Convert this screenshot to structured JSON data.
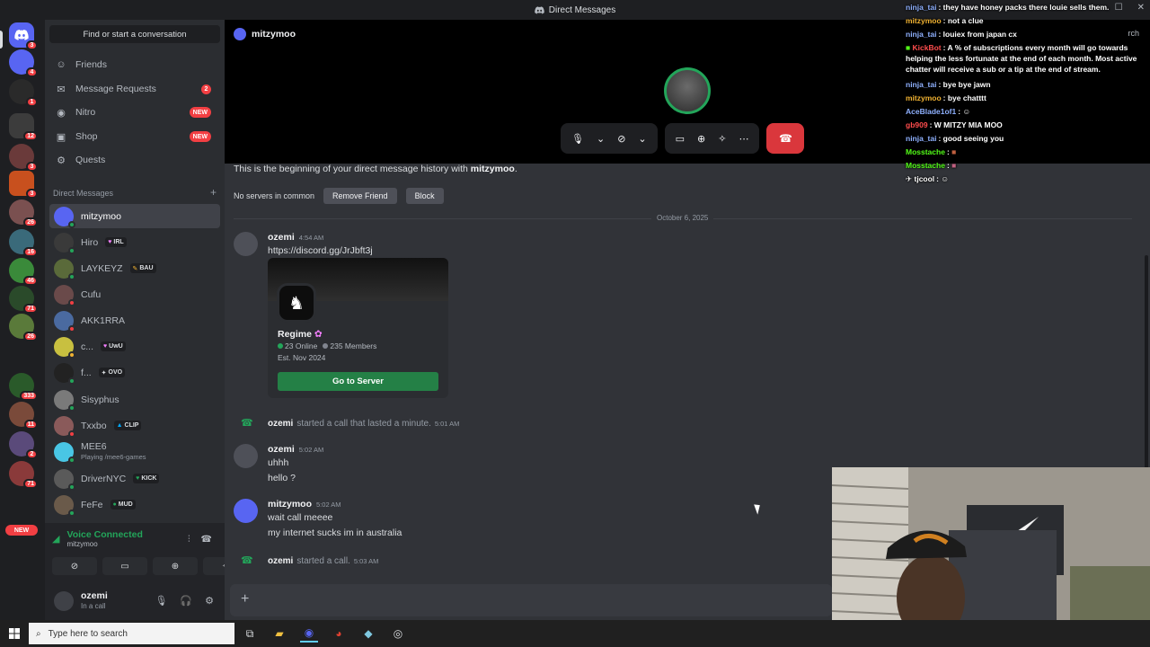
{
  "window": {
    "title": "Direct Messages"
  },
  "rail": {
    "badges": [
      "3",
      "4",
      "1",
      "12",
      "3",
      "3",
      "26",
      "16",
      "46",
      "71",
      "26",
      "333",
      "11",
      "2",
      "71"
    ],
    "new_label": "NEW"
  },
  "sidebar": {
    "find_placeholder": "Find or start a conversation",
    "nav": [
      {
        "label": "Friends",
        "icon": "friends-icon"
      },
      {
        "label": "Message Requests",
        "icon": "mail-icon",
        "count": "2"
      },
      {
        "label": "Nitro",
        "icon": "nitro-icon",
        "tag": "NEW"
      },
      {
        "label": "Shop",
        "icon": "shop-icon",
        "tag": "NEW"
      },
      {
        "label": "Quests",
        "icon": "quests-icon"
      }
    ],
    "dm_header": "Direct Messages",
    "dms": [
      {
        "name": "mitzymoo",
        "status": "online",
        "color": "#5865f2"
      },
      {
        "name": "Hiro",
        "tag": "IRL",
        "status": "online",
        "color": "#3a3a3a"
      },
      {
        "name": "LAYKEYZ",
        "tag": "BAU",
        "status": "online",
        "color": "#5a6a3a"
      },
      {
        "name": "Cufu",
        "status": "dnd",
        "color": "#6a4a4a"
      },
      {
        "name": "AKK1RRA",
        "status": "dnd",
        "color": "#4a6aa0"
      },
      {
        "name": "c...",
        "tag": "UwU",
        "status": "idle",
        "color": "#c8c040"
      },
      {
        "name": "f...",
        "tag": "OVO",
        "status": "online",
        "color": "#222222"
      },
      {
        "name": "Sisyphus",
        "status": "online",
        "color": "#7a7a7a"
      },
      {
        "name": "Txxbo",
        "tag": "CLIP",
        "status": "dnd",
        "color": "#8a5a5a"
      },
      {
        "name": "MEE6",
        "sub": "Playing /mee6-games",
        "status": "online",
        "color": "#49c6e5"
      },
      {
        "name": "DriverNYC",
        "tag": "KICK",
        "status": "online",
        "color": "#5a5a5a"
      },
      {
        "name": "FeFe",
        "tag": "MUD",
        "status": "online",
        "color": "#6a5a4a"
      }
    ]
  },
  "voice": {
    "title": "Voice Connected",
    "channel": "mitzymoo"
  },
  "user": {
    "name": "ozemi",
    "status": "In a call"
  },
  "call": {
    "header": "mitzymoo"
  },
  "chat": {
    "intro_prefix": "This is the beginning of your direct message history with ",
    "intro_name": "mitzymoo",
    "servers_in_common": "No servers in common",
    "remove_friend": "Remove Friend",
    "block": "Block",
    "date_divider": "October 6, 2025",
    "msg1": {
      "author": "ozemi",
      "time": "4:54 AM",
      "link": "https://discord.gg/JrJbft3j"
    },
    "invite": {
      "server_name": "Regime",
      "online": "23 Online",
      "members": "235 Members",
      "established": "Est. Nov 2024",
      "button": "Go to Server"
    },
    "sys1": {
      "author": "ozemi",
      "text": "started a call that lasted a minute.",
      "time": "5:01 AM"
    },
    "msg2": {
      "author": "ozemi",
      "time": "5:02 AM",
      "lines": [
        "uhhh",
        "hello ?"
      ]
    },
    "msg3": {
      "author": "mitzymoo",
      "time": "5:02 AM",
      "lines": [
        "wait call meeee",
        "my internet sucks im in australia"
      ]
    },
    "sys2": {
      "author": "ozemi",
      "text": "started a call.",
      "time": "5:03 AM"
    }
  },
  "overlay_chat": [
    {
      "user": "ninja_tai",
      "color": "#8fb1ff",
      "text": ": they have honey packs there louie sells them."
    },
    {
      "user": "mitzymoo",
      "color": "#f0b232",
      "text": ": not a clue"
    },
    {
      "user": "ninja_tai",
      "color": "#8fb1ff",
      "text": ": louiex from japan cx"
    },
    {
      "user": "KickBot",
      "color": "#ff4d4d",
      "text": ": A % of subscriptions every month will go towards helping the less fortunate at the end of each month. Most active chatter will receive a sub or a tip at the end of stream."
    },
    {
      "user": "ninja_tai",
      "color": "#8fb1ff",
      "text": ": bye bye jawn"
    },
    {
      "user": "mitzymoo",
      "color": "#f0b232",
      "text": ": bye chatttt"
    },
    {
      "user": "AceBlade1of1",
      "color": "#8fb1ff",
      "text": ":"
    },
    {
      "user": "gb909",
      "color": "#ff4d4d",
      "text": ": W MITZY MIA MOO"
    },
    {
      "user": "ninja_tai",
      "color": "#8fb1ff",
      "text": ": good seeing you"
    },
    {
      "user": "Mosstache",
      "color": "#53fc18",
      "text": ":"
    },
    {
      "user": "Mosstache",
      "color": "#53fc18",
      "text": ":"
    },
    {
      "user": "tjcool",
      "color": "#ffffff",
      "text": ":"
    }
  ],
  "search_fragment": "rch",
  "taskbar": {
    "search_placeholder": "Type here to search"
  }
}
